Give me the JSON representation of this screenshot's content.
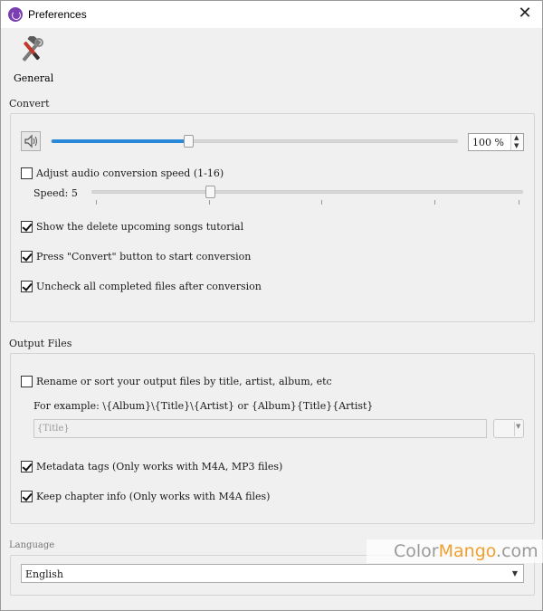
{
  "window": {
    "title": "Preferences"
  },
  "toolbar": {
    "general_label": "General"
  },
  "convert": {
    "section_title": "Convert",
    "volume_value": "100 %",
    "volume_percent": 100,
    "adjust_speed_label": "Adjust audio conversion speed (1-16)",
    "speed_label": "Speed: 5",
    "speed_value": 5,
    "show_tutorial_label": "Show the delete upcoming songs tutorial",
    "press_convert_label": "Press \"Convert\" button to start conversion",
    "uncheck_completed_label": "Uncheck all completed files after conversion"
  },
  "output": {
    "section_title": "Output Files",
    "rename_label": "Rename or sort your output files by title, artist, album, etc",
    "example_text": "For example: \\{Album}\\{Title}\\{Artist} or {Album}{Title}{Artist}",
    "pattern_placeholder": "{Title}",
    "metadata_label": "Metadata tags (Only works with M4A, MP3 files)",
    "chapter_label": "Keep chapter info (Only works with M4A files)"
  },
  "language": {
    "section_title": "Language",
    "selected": "English"
  },
  "watermark": {
    "part1": "Color",
    "part2": "Mango",
    "part3": ".com"
  },
  "colors": {
    "accent": "#2a88d8",
    "brand": "#7b3fb3"
  }
}
